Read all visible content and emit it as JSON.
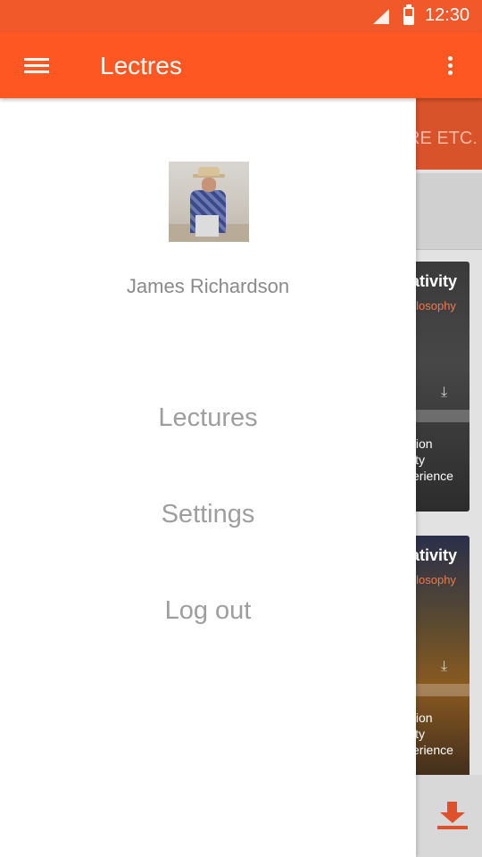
{
  "status_bar": {
    "time": "12:30",
    "icons": [
      "signal-icon",
      "battery-icon"
    ]
  },
  "app_bar": {
    "title": "Lectres",
    "menu_icon": "hamburger-menu-icon",
    "overflow_icon": "more-vert-icon"
  },
  "drawer": {
    "user_name": "James Richardson",
    "menu": [
      {
        "label": "Lectures"
      },
      {
        "label": "Settings"
      },
      {
        "label": "Log out"
      }
    ]
  },
  "background": {
    "tabs_text": "RE ETC.",
    "cards": [
      {
        "title": "ativity",
        "subtitle": "hilosophy",
        "lines": [
          "tion",
          "ity",
          "erience"
        ]
      },
      {
        "title": "ativity",
        "subtitle": "hilosophy",
        "lines": [
          "tion",
          "ity",
          "erience"
        ]
      }
    ]
  },
  "colors": {
    "status_bar": "#f2592a",
    "app_bar": "#ff5722",
    "accent": "#e0502a",
    "drawer_background": "#ffffff",
    "drawer_text": "#9e9e9e"
  }
}
